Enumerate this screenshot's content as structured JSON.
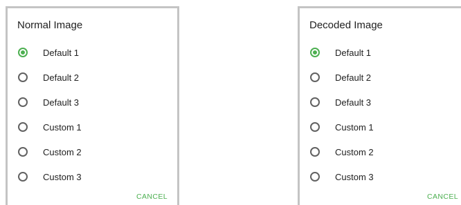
{
  "dialogs": [
    {
      "title": "Normal Image",
      "options": [
        {
          "label": "Default 1",
          "selected": true
        },
        {
          "label": "Default 2",
          "selected": false
        },
        {
          "label": "Default 3",
          "selected": false
        },
        {
          "label": "Custom 1",
          "selected": false
        },
        {
          "label": "Custom 2",
          "selected": false
        },
        {
          "label": "Custom 3",
          "selected": false
        }
      ],
      "cancel_label": "CANCEL"
    },
    {
      "title": "Decoded Image",
      "options": [
        {
          "label": "Default 1",
          "selected": true
        },
        {
          "label": "Default 2",
          "selected": false
        },
        {
          "label": "Default 3",
          "selected": false
        },
        {
          "label": "Custom 1",
          "selected": false
        },
        {
          "label": "Custom 2",
          "selected": false
        },
        {
          "label": "Custom 3",
          "selected": false
        }
      ],
      "cancel_label": "CANCEL"
    }
  ],
  "colors": {
    "accent": "#4caf50",
    "radio_unchecked": "#616161",
    "text": "#212121",
    "dialog_border": "#c4c4c4"
  }
}
